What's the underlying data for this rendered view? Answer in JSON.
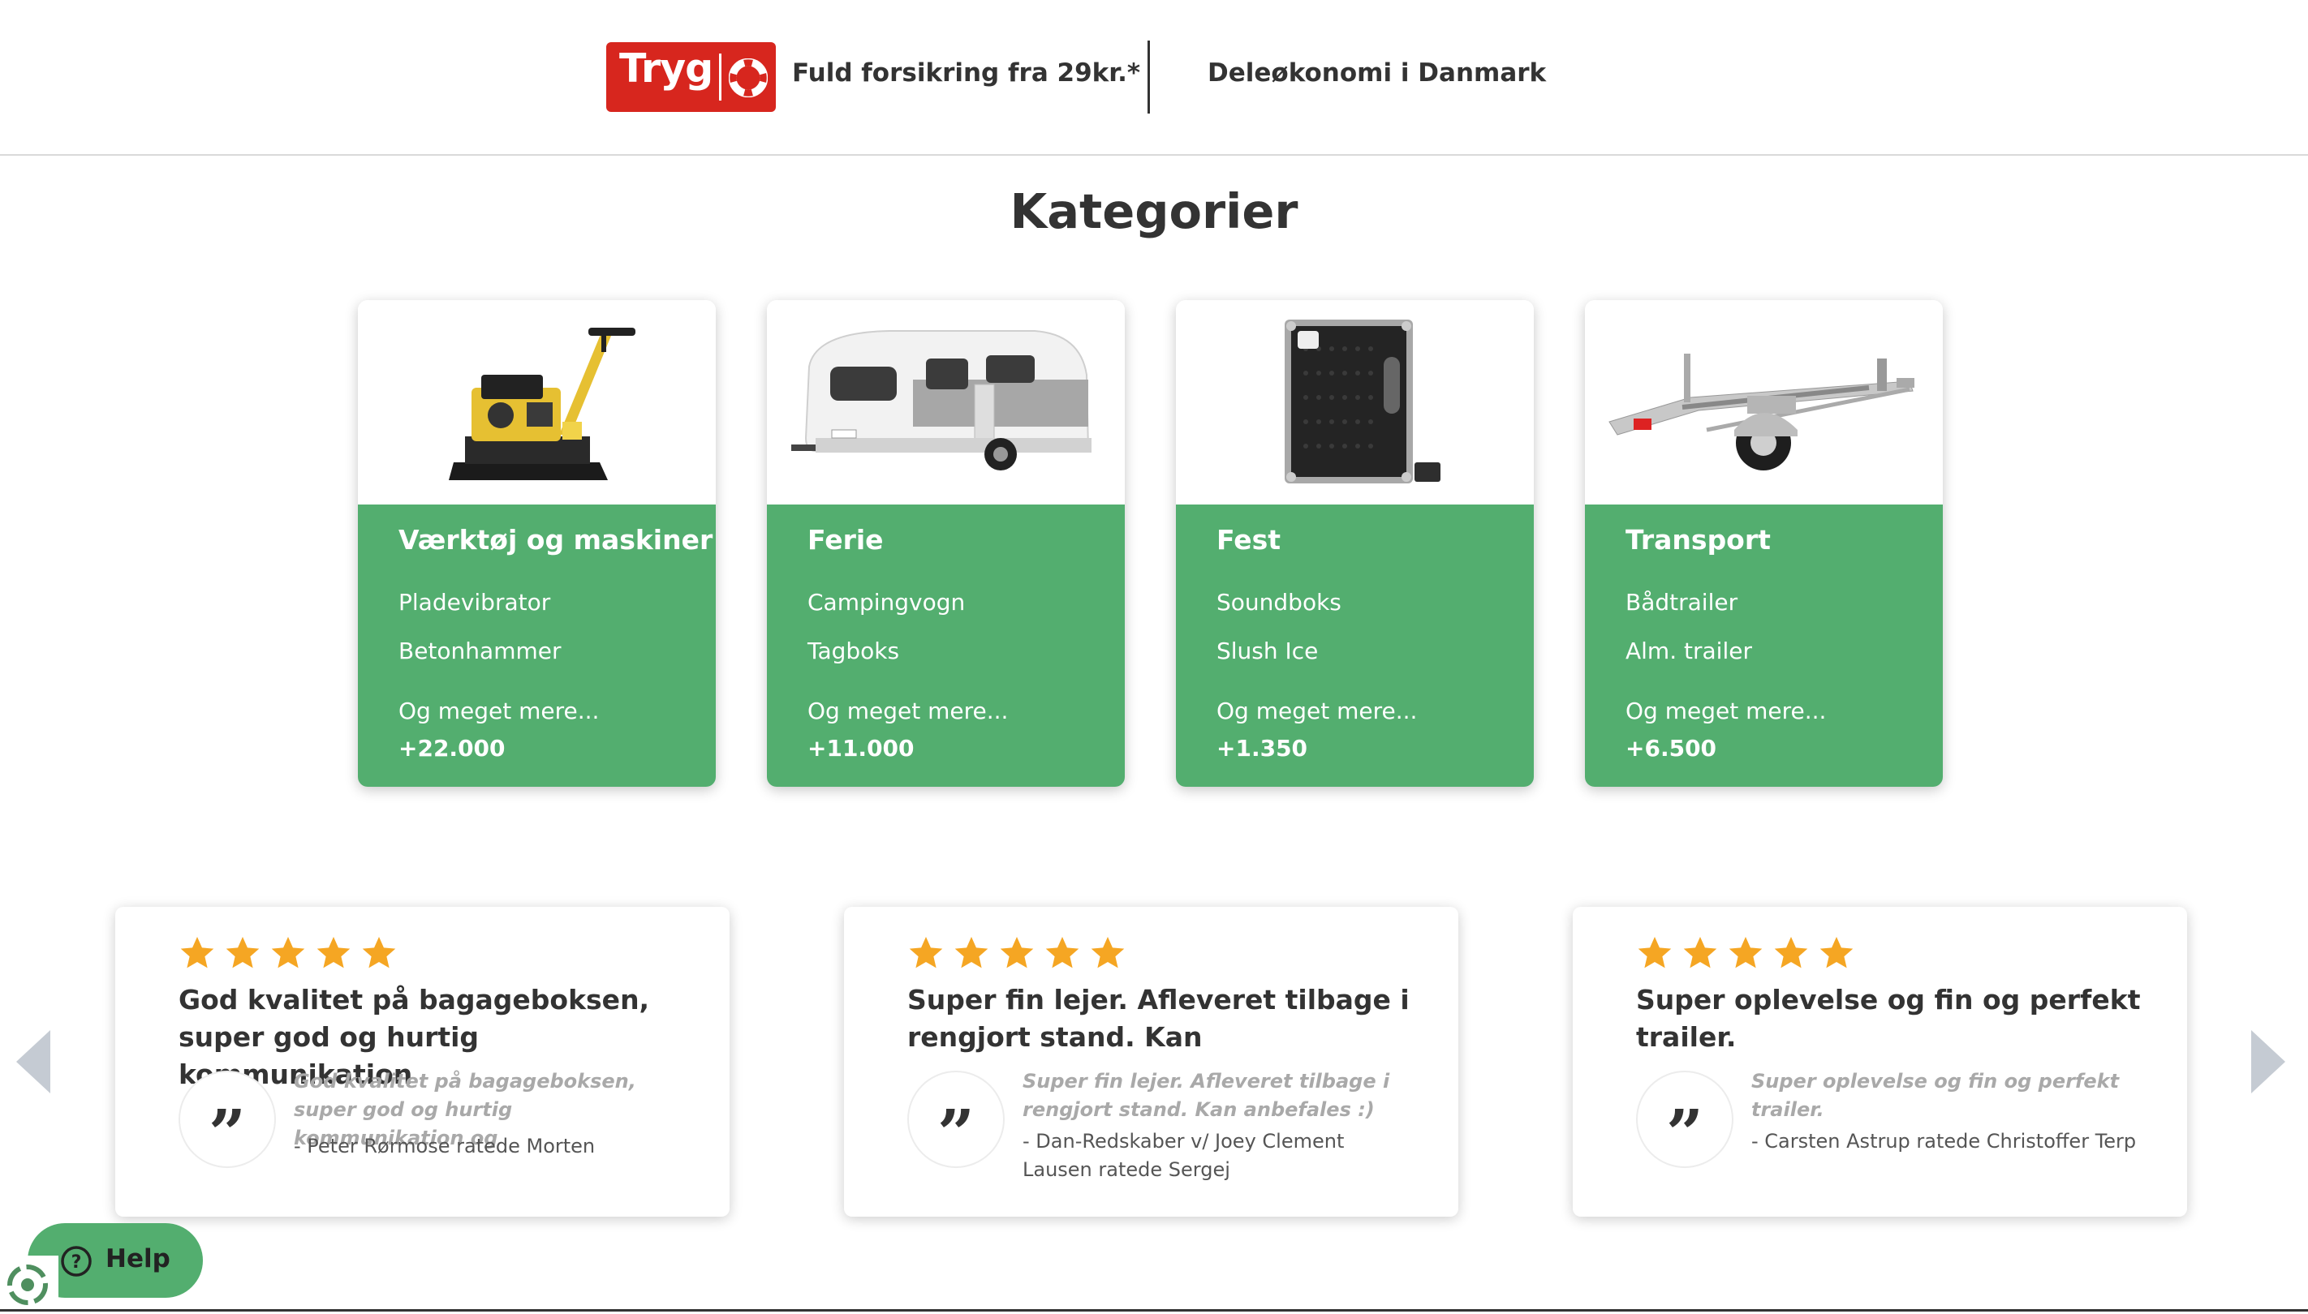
{
  "header": {
    "brand_logo_text": "Tryg",
    "tagline": "Fuld forsikring fra 29kr.*",
    "share_link": "Deleøkonomi i Danmark"
  },
  "categories_title": "Kategorier",
  "categories": [
    {
      "title": "Værktøj og maskiner",
      "items": [
        "Pladevibrator",
        "Betonhammer"
      ],
      "more": "Og meget mere...",
      "count": "+22.000"
    },
    {
      "title": "Ferie",
      "items": [
        "Campingvogn",
        "Tagboks"
      ],
      "more": "Og meget mere...",
      "count": "+11.000"
    },
    {
      "title": "Fest",
      "items": [
        "Soundboks",
        "Slush Ice"
      ],
      "more": "Og meget mere...",
      "count": "+1.350"
    },
    {
      "title": "Transport",
      "items": [
        "Bådtrailer",
        "Alm. trailer"
      ],
      "more": "Og meget mere...",
      "count": "+6.500"
    }
  ],
  "reviews": [
    {
      "rating": 5,
      "headline": "God kvalitet på bagageboksen, super god og hurtig kommunikation",
      "text": "God kvalitet på bagageboksen, super god og hurtig kommunikation og",
      "author": "- Peter Rørmose ratede Morten"
    },
    {
      "rating": 5,
      "headline": "Super fin lejer. Afleveret tilbage i rengjort stand. Kan",
      "text": "Super fin lejer. Afleveret tilbage i rengjort stand. Kan anbefales :)",
      "author": "- Dan-Redskaber v/ Joey Clement Lausen ratede Sergej"
    },
    {
      "rating": 5,
      "headline": "Super oplevelse og fin og perfekt trailer.",
      "text": "Super oplevelse og fin og perfekt trailer.",
      "author": "- Carsten Astrup ratede Christoffer Terp"
    }
  ],
  "help_button": {
    "label": "Help"
  },
  "colors": {
    "brand_red": "#d7261e",
    "category_green": "#53ae6f",
    "star_orange": "#f5a623",
    "text_dark": "#333333"
  },
  "icons": [
    "life-ring-icon",
    "star-icon",
    "quote-icon",
    "arrow-left-icon",
    "arrow-right-icon",
    "help-icon"
  ]
}
